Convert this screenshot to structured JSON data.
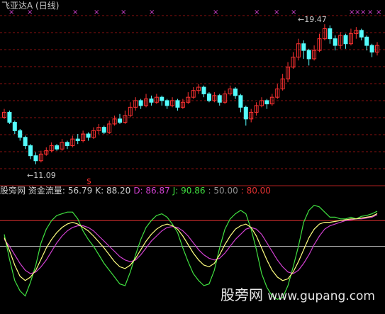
{
  "title": "飞亚达A (日线)",
  "price_labels": {
    "high": "19.47",
    "low": "11.09"
  },
  "signal_mark": "$",
  "indicator": {
    "name": "股旁网 资金流量:",
    "items": [
      {
        "key": "value",
        "text": "56.79",
        "color": "#d0d0d0"
      },
      {
        "key": "K",
        "text": "K: 88.20",
        "color": "#d0d0d0"
      },
      {
        "key": "D",
        "text": "D: 86.87",
        "color": "#d040d0"
      },
      {
        "key": "J",
        "text": "J: 90.86",
        "color": "#40e040"
      },
      {
        "key": "level50",
        "text": ": 50.00",
        "color": "#909090"
      },
      {
        "key": "level80",
        "text": ": 80.00",
        "color": "#e03030"
      }
    ]
  },
  "watermark": {
    "cn": "股旁网",
    "url": "www.gupang.com"
  },
  "colors": {
    "up": "#ff3232",
    "down": "#54fcfc",
    "grid": "#8a1010",
    "k": "#ffff80",
    "d": "#d040d0",
    "j": "#40e040",
    "line50": "#b0b0b0",
    "line80": "#e03030",
    "marker": "#d040d0"
  },
  "chart_data": {
    "type": "candlestick",
    "price_axis": {
      "high": 19.47,
      "low": 11.09
    },
    "candles": [
      [
        13.9,
        14.2,
        14.4,
        13.8
      ],
      [
        14.2,
        13.6,
        14.3,
        13.5
      ],
      [
        13.6,
        13.1,
        13.7,
        12.9
      ],
      [
        13.1,
        12.7,
        13.2,
        12.5
      ],
      [
        12.7,
        12.2,
        12.8,
        12.0
      ],
      [
        12.2,
        11.6,
        12.3,
        11.4
      ],
      [
        11.6,
        11.3,
        11.8,
        11.09
      ],
      [
        11.3,
        11.7,
        11.9,
        11.2
      ],
      [
        11.7,
        11.9,
        12.1,
        11.6
      ],
      [
        11.9,
        12.2,
        12.4,
        11.8
      ],
      [
        12.2,
        12.0,
        12.3,
        11.9
      ],
      [
        12.0,
        12.4,
        12.6,
        11.9
      ],
      [
        12.4,
        12.2,
        12.5,
        12.0
      ],
      [
        12.2,
        12.6,
        12.8,
        12.1
      ],
      [
        12.6,
        12.5,
        12.9,
        12.3
      ],
      [
        12.5,
        12.9,
        13.1,
        12.4
      ],
      [
        12.9,
        12.7,
        13.0,
        12.5
      ],
      [
        12.7,
        13.1,
        13.3,
        12.6
      ],
      [
        13.1,
        13.3,
        13.5,
        12.9
      ],
      [
        13.3,
        13.0,
        13.4,
        12.9
      ],
      [
        13.0,
        13.5,
        13.7,
        12.9
      ],
      [
        13.5,
        13.8,
        14.0,
        13.4
      ],
      [
        13.8,
        13.6,
        14.1,
        13.5
      ],
      [
        13.6,
        14.0,
        14.3,
        13.5
      ],
      [
        14.0,
        14.5,
        14.8,
        13.9
      ],
      [
        14.5,
        14.9,
        15.1,
        14.3
      ],
      [
        14.9,
        14.6,
        15.0,
        14.4
      ],
      [
        14.6,
        15.0,
        15.3,
        14.5
      ],
      [
        15.0,
        14.8,
        15.2,
        14.6
      ],
      [
        14.8,
        15.1,
        15.3,
        14.7
      ],
      [
        15.1,
        14.9,
        15.2,
        14.6
      ],
      [
        14.9,
        14.6,
        15.0,
        14.4
      ],
      [
        14.6,
        14.9,
        15.1,
        14.5
      ],
      [
        14.9,
        14.5,
        15.0,
        14.3
      ],
      [
        14.5,
        14.8,
        15.0,
        14.4
      ],
      [
        14.8,
        15.1,
        15.4,
        14.7
      ],
      [
        15.1,
        15.5,
        15.7,
        15.0
      ],
      [
        15.5,
        15.7,
        15.9,
        15.3
      ],
      [
        15.7,
        15.3,
        15.8,
        15.1
      ],
      [
        15.3,
        14.9,
        15.4,
        14.8
      ],
      [
        14.9,
        15.2,
        15.4,
        14.8
      ],
      [
        15.2,
        14.8,
        15.3,
        14.6
      ],
      [
        14.8,
        15.3,
        15.5,
        14.7
      ],
      [
        15.3,
        15.6,
        15.8,
        15.2
      ],
      [
        15.6,
        15.2,
        15.7,
        15.0
      ],
      [
        15.2,
        14.5,
        15.3,
        14.2
      ],
      [
        14.5,
        13.8,
        14.6,
        13.4
      ],
      [
        13.8,
        14.2,
        14.4,
        13.6
      ],
      [
        14.2,
        14.6,
        14.8,
        14.0
      ],
      [
        14.6,
        14.9,
        15.1,
        14.5
      ],
      [
        14.9,
        14.7,
        15.0,
        14.4
      ],
      [
        14.7,
        15.1,
        15.3,
        14.6
      ],
      [
        15.1,
        15.6,
        15.9,
        15.0
      ],
      [
        15.6,
        16.2,
        16.5,
        15.5
      ],
      [
        16.2,
        16.9,
        17.2,
        16.0
      ],
      [
        16.9,
        17.5,
        17.8,
        16.8
      ],
      [
        17.5,
        18.3,
        18.6,
        17.3
      ],
      [
        18.3,
        17.9,
        18.5,
        17.4
      ],
      [
        17.9,
        17.4,
        18.0,
        17.0
      ],
      [
        17.4,
        17.9,
        18.2,
        17.3
      ],
      [
        17.9,
        18.6,
        18.9,
        17.8
      ],
      [
        18.6,
        19.2,
        19.47,
        18.5
      ],
      [
        19.2,
        18.6,
        19.4,
        18.3
      ],
      [
        18.6,
        18.2,
        18.8,
        17.9
      ],
      [
        18.2,
        18.8,
        19.0,
        18.0
      ],
      [
        18.8,
        18.3,
        18.9,
        18.0
      ],
      [
        18.3,
        18.9,
        19.2,
        18.2
      ],
      [
        18.9,
        19.1,
        19.3,
        18.6
      ],
      [
        19.1,
        18.7,
        19.2,
        18.5
      ],
      [
        18.7,
        18.2,
        18.8,
        17.9
      ],
      [
        18.2,
        17.8,
        18.3,
        17.5
      ],
      [
        17.8,
        18.2,
        18.4,
        17.6
      ]
    ],
    "indicator_series": {
      "K": [
        60,
        45,
        28,
        15,
        10,
        14,
        22,
        35,
        48,
        58,
        66,
        72,
        76,
        78,
        76,
        72,
        68,
        62,
        55,
        48,
        40,
        32,
        26,
        24,
        28,
        36,
        46,
        56,
        64,
        70,
        74,
        76,
        74,
        70,
        62,
        52,
        42,
        34,
        28,
        26,
        30,
        40,
        52,
        62,
        70,
        74,
        76,
        72,
        62,
        48,
        34,
        22,
        14,
        10,
        12,
        20,
        32,
        46,
        60,
        70,
        76,
        78,
        78,
        79,
        80,
        81,
        82,
        82,
        83,
        84,
        85,
        88.2
      ],
      "D": [
        58,
        50,
        40,
        30,
        22,
        18,
        20,
        26,
        34,
        44,
        54,
        62,
        68,
        72,
        74,
        74,
        72,
        68,
        62,
        56,
        50,
        44,
        38,
        34,
        32,
        34,
        40,
        48,
        56,
        62,
        68,
        72,
        73,
        72,
        68,
        62,
        54,
        46,
        40,
        36,
        34,
        36,
        42,
        50,
        58,
        64,
        70,
        72,
        70,
        64,
        54,
        44,
        34,
        26,
        20,
        18,
        22,
        30,
        40,
        52,
        62,
        70,
        74,
        76,
        78,
        80,
        81,
        82,
        82,
        83,
        84,
        86.87
      ],
      "J": [
        64,
        35,
        10,
        -2,
        -8,
        8,
        28,
        54,
        70,
        80,
        86,
        88,
        90,
        90,
        82,
        68,
        58,
        50,
        40,
        30,
        22,
        14,
        6,
        4,
        20,
        40,
        58,
        72,
        80,
        86,
        88,
        84,
        76,
        66,
        48,
        32,
        18,
        10,
        4,
        6,
        22,
        48,
        70,
        82,
        88,
        92,
        88,
        70,
        46,
        18,
        2,
        -8,
        -12,
        -10,
        4,
        26,
        50,
        78,
        92,
        98,
        96,
        90,
        84,
        84,
        82,
        82,
        84,
        82,
        85,
        86,
        88,
        90.86
      ],
      "level50": 50,
      "level80": 80
    }
  }
}
